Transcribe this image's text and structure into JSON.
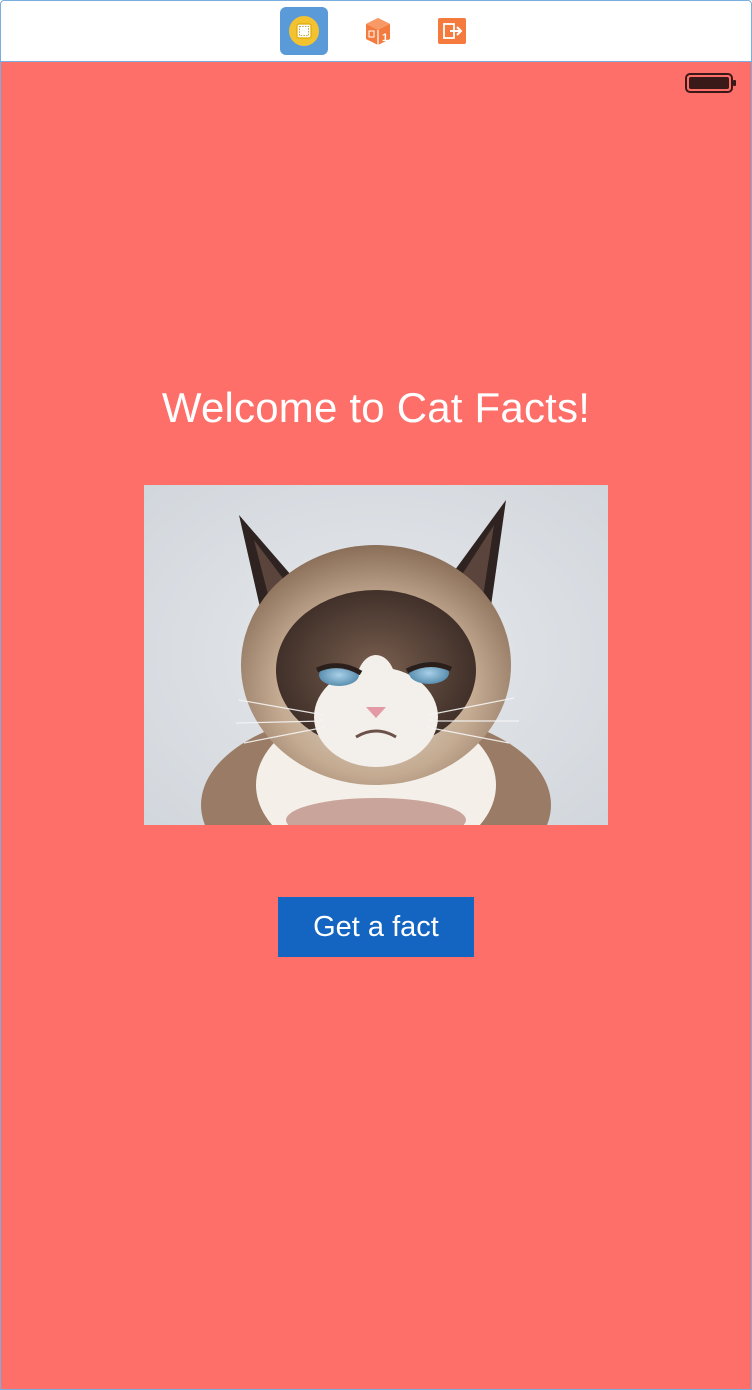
{
  "scene_dock": {
    "items": [
      {
        "icon": "view-controller-icon",
        "selected": true
      },
      {
        "icon": "first-responder-icon",
        "selected": false
      },
      {
        "icon": "exit-icon",
        "selected": false
      }
    ]
  },
  "status_bar": {
    "battery_icon": "battery-full-icon"
  },
  "main": {
    "title": "Welcome to Cat Facts!",
    "image_alt": "grumpy-cat-photo",
    "button_label": "Get a fact"
  },
  "colors": {
    "background": "#ff6f69",
    "button": "#1465c2",
    "text": "#ffffff",
    "dock_selected": "#5b9ad9"
  }
}
